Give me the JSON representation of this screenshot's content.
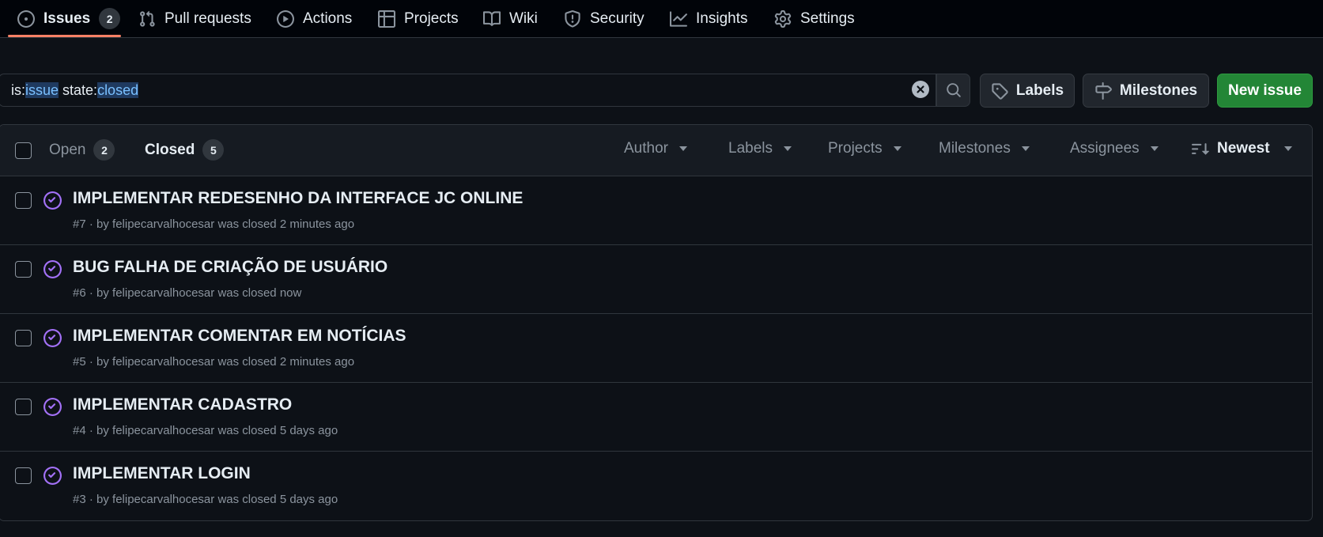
{
  "nav": {
    "tabs": [
      {
        "label": "Issues",
        "icon": "issue-opened-icon",
        "count": "2"
      },
      {
        "label": "Pull requests",
        "icon": "git-pull-request-icon"
      },
      {
        "label": "Actions",
        "icon": "play-icon"
      },
      {
        "label": "Projects",
        "icon": "table-icon"
      },
      {
        "label": "Wiki",
        "icon": "book-icon"
      },
      {
        "label": "Security",
        "icon": "shield-icon"
      },
      {
        "label": "Insights",
        "icon": "graph-icon"
      },
      {
        "label": "Settings",
        "icon": "gear-icon"
      }
    ],
    "active_tab": "Issues",
    "accent_color": "#f78166"
  },
  "search": {
    "query_parts": [
      {
        "text": "is:",
        "highlight": false
      },
      {
        "text": "issue",
        "highlight": true
      },
      {
        "text": " state:",
        "highlight": false
      },
      {
        "text": "closed",
        "highlight": true
      }
    ]
  },
  "buttons": {
    "labels": "Labels",
    "milestones": "Milestones",
    "new_issue": "New issue",
    "new_issue_color": "#238636"
  },
  "list_header": {
    "open_label": "Open",
    "open_count": "2",
    "closed_label": "Closed",
    "closed_count": "5",
    "filters": [
      "Author",
      "Labels",
      "Projects",
      "Milestones",
      "Assignees"
    ],
    "sort_label": "Newest"
  },
  "issues": [
    {
      "title": "IMPLEMENTAR REDESENHO DA INTERFACE JC ONLINE",
      "number": "#7",
      "by": " · by ",
      "author": "felipecarvalhocesar",
      "status": " was closed 2 minutes ago"
    },
    {
      "title": "BUG FALHA DE CRIAÇÃO DE USUÁRIO",
      "number": "#6",
      "by": " · by ",
      "author": "felipecarvalhocesar",
      "status": " was closed now"
    },
    {
      "title": "IMPLEMENTAR COMENTAR EM NOTÍCIAS",
      "number": "#5",
      "by": " · by ",
      "author": "felipecarvalhocesar",
      "status": " was closed 2 minutes ago"
    },
    {
      "title": "IMPLEMENTAR CADASTRO",
      "number": "#4",
      "by": " · by ",
      "author": "felipecarvalhocesar",
      "status": " was closed 5 days ago"
    },
    {
      "title": "IMPLEMENTAR LOGIN",
      "number": "#3",
      "by": " · by ",
      "author": "felipecarvalhocesar",
      "status": " was closed 5 days ago"
    }
  ],
  "closed_icon_color": "#a371f7"
}
